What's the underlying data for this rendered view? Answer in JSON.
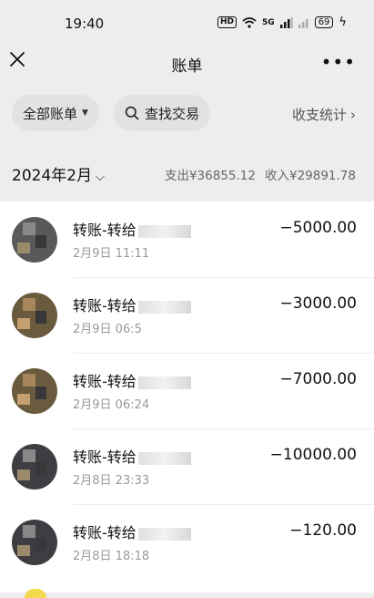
{
  "status": {
    "time": "19:40",
    "hd": "HD",
    "signal": "5G",
    "battery": "69"
  },
  "nav": {
    "title": "账单",
    "more_label": "•••"
  },
  "filters": {
    "all_label": "全部账单",
    "search_label": "查找交易",
    "stats_label": "收支统计"
  },
  "month": {
    "label": "2024年2月",
    "expense": "支出¥36855.12",
    "income": "收入¥29891.78"
  },
  "transactions": [
    {
      "title": "转账-转给",
      "date": "2月9日 11:11",
      "amount": "−5000.00"
    },
    {
      "title": "转账-转给",
      "date": "2月9日 06:5",
      "amount": "−3000.00"
    },
    {
      "title": "转账-转给",
      "date": "2月9日 06:24",
      "amount": "−7000.00"
    },
    {
      "title": "转账-转给",
      "date": "2月8日 23:33",
      "amount": "−10000.00"
    },
    {
      "title": "转账-转给",
      "date": "2月8日 18:18",
      "amount": "−120.00"
    }
  ]
}
